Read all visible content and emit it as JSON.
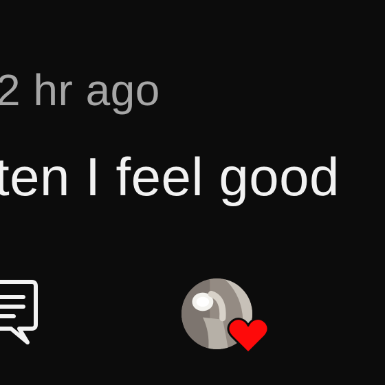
{
  "comment": {
    "timestamp": "2 hr ago",
    "text": "ten I feel good"
  },
  "actions": {
    "reply_icon": "comment-bubble-icon",
    "creator_like_icon": "heart-icon"
  },
  "colors": {
    "background": "#0c0c0c",
    "text_primary": "#f2f2f2",
    "text_secondary": "#a6a6a6",
    "heart": "#fe0a0a"
  }
}
